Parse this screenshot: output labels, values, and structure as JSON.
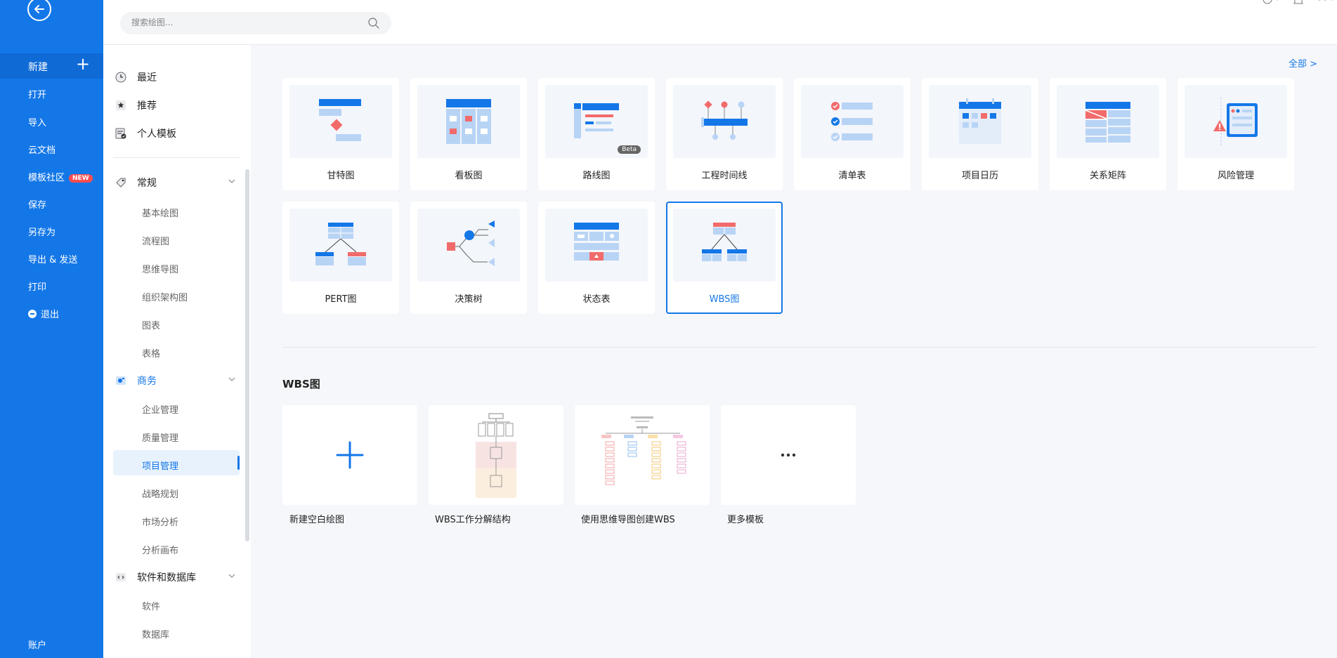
{
  "sidebar": {
    "new_label": "新建",
    "items": [
      {
        "label": "打开"
      },
      {
        "label": "导入"
      },
      {
        "label": "云文档"
      },
      {
        "label": "模板社区",
        "badge": "NEW"
      },
      {
        "label": "保存"
      },
      {
        "label": "另存为"
      },
      {
        "label": "导出 & 发送"
      },
      {
        "label": "打印"
      },
      {
        "label": "退出"
      }
    ],
    "account_label": "账户",
    "accent_color": "#1477e8"
  },
  "search": {
    "placeholder": "搜索绘图..."
  },
  "categories": {
    "top": [
      {
        "label": "最近",
        "icon": "clock-icon"
      },
      {
        "label": "推荐",
        "icon": "star-icon"
      },
      {
        "label": "个人模板",
        "icon": "personal-template-icon"
      }
    ],
    "groups": [
      {
        "label": "常规",
        "icon": "tag-icon",
        "items": [
          "基本绘图",
          "流程图",
          "思维导图",
          "组织架构图",
          "图表",
          "表格"
        ]
      },
      {
        "label": "商务",
        "icon": "business-icon",
        "active": true,
        "items": [
          "企业管理",
          "质量管理",
          "项目管理",
          "战略规划",
          "市场分析",
          "分析画布"
        ],
        "selected_item": "项目管理"
      },
      {
        "label": "软件和数据库",
        "icon": "code-icon",
        "items": [
          "软件",
          "数据库"
        ]
      }
    ]
  },
  "main": {
    "all_link": "全部 >",
    "templates": [
      {
        "label": "甘特图"
      },
      {
        "label": "看板图"
      },
      {
        "label": "路线图",
        "badge": "Beta"
      },
      {
        "label": "工程时间线"
      },
      {
        "label": "清单表"
      },
      {
        "label": "项目日历"
      },
      {
        "label": "关系矩阵"
      },
      {
        "label": "风险管理"
      },
      {
        "label": "PERT图"
      },
      {
        "label": "决策树"
      },
      {
        "label": "状态表"
      },
      {
        "label": "WBS图",
        "selected": true
      }
    ],
    "section_title": "WBS图",
    "diagrams": [
      {
        "label": "新建空白绘图"
      },
      {
        "label": "WBS工作分解结构"
      },
      {
        "label": "使用思维导图创建WBS"
      },
      {
        "label": "更多模板"
      }
    ]
  }
}
